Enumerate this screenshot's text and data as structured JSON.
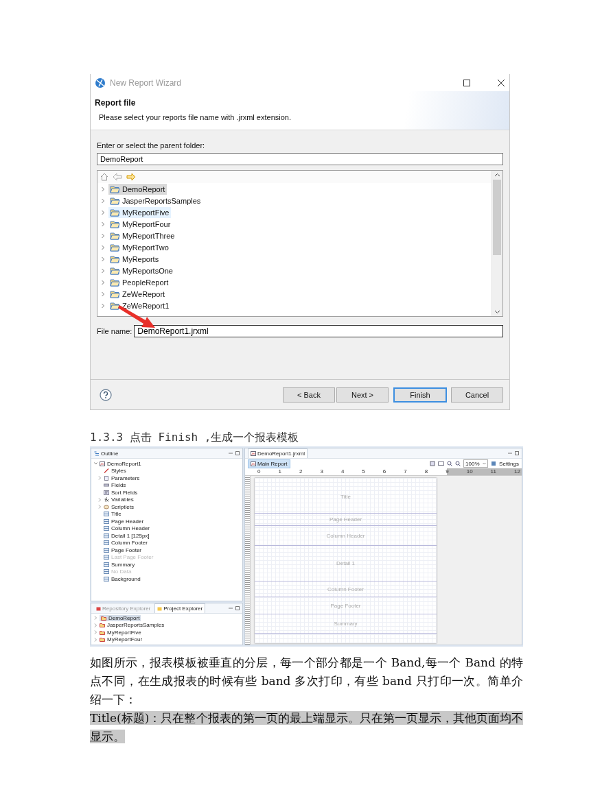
{
  "dialog": {
    "title": "New Report Wizard",
    "heading": "Report file",
    "description": "Please select your reports file name with .jrxml extension.",
    "folder_label": "Enter or select the parent folder:",
    "folder_value": "DemoReport",
    "folders": [
      {
        "name": "DemoReport",
        "selected": true,
        "hovered": false
      },
      {
        "name": "JasperReportsSamples",
        "selected": false,
        "hovered": false
      },
      {
        "name": "MyReportFive",
        "selected": false,
        "hovered": true
      },
      {
        "name": "MyReportFour",
        "selected": false,
        "hovered": false
      },
      {
        "name": "MyReportThree",
        "selected": false,
        "hovered": false
      },
      {
        "name": "MyReportTwo",
        "selected": false,
        "hovered": false
      },
      {
        "name": "MyReports",
        "selected": false,
        "hovered": false
      },
      {
        "name": "MyReportsOne",
        "selected": false,
        "hovered": false
      },
      {
        "name": "PeopleReport",
        "selected": false,
        "hovered": false
      },
      {
        "name": "ZeWeReport",
        "selected": false,
        "hovered": false
      },
      {
        "name": "ZeWeReport1",
        "selected": false,
        "hovered": false
      }
    ],
    "file_label": "File name:",
    "file_value": "DemoReport1.jrxml",
    "buttons": [
      {
        "label": "< Back",
        "default": false
      },
      {
        "label": "Next >",
        "default": false
      },
      {
        "label": "Finish",
        "default": true
      },
      {
        "label": "Cancel",
        "default": false
      }
    ]
  },
  "heading": "1.3.3 点击 Finish ,生成一个报表模板",
  "ide": {
    "outline": {
      "title": "Outline",
      "root": "DemoReport1",
      "items": [
        {
          "label": "Styles",
          "kind": "styles",
          "expandable": false,
          "disabled": false
        },
        {
          "label": "Parameters",
          "kind": "parameters",
          "expandable": true,
          "disabled": false
        },
        {
          "label": "Fields",
          "kind": "fields",
          "expandable": false,
          "disabled": false
        },
        {
          "label": "Sort Fields",
          "kind": "sort",
          "expandable": false,
          "disabled": false
        },
        {
          "label": "Variables",
          "kind": "variables",
          "expandable": true,
          "disabled": false
        },
        {
          "label": "Scriptlets",
          "kind": "scriptlets",
          "expandable": true,
          "disabled": false
        },
        {
          "label": "Title",
          "kind": "band",
          "expandable": false,
          "disabled": false
        },
        {
          "label": "Page Header",
          "kind": "band",
          "expandable": false,
          "disabled": false
        },
        {
          "label": "Column Header",
          "kind": "band",
          "expandable": false,
          "disabled": false
        },
        {
          "label": "Detail 1 [125px]",
          "kind": "band",
          "expandable": false,
          "disabled": false
        },
        {
          "label": "Column Footer",
          "kind": "band",
          "expandable": false,
          "disabled": false
        },
        {
          "label": "Page Footer",
          "kind": "band",
          "expandable": false,
          "disabled": false
        },
        {
          "label": "Last Page Footer",
          "kind": "band",
          "expandable": false,
          "disabled": true
        },
        {
          "label": "Summary",
          "kind": "band",
          "expandable": false,
          "disabled": false
        },
        {
          "label": "No Data",
          "kind": "band",
          "expandable": false,
          "disabled": true
        },
        {
          "label": "Background",
          "kind": "band",
          "expandable": false,
          "disabled": false
        }
      ]
    },
    "explorer": {
      "tabs": [
        {
          "label": "Repository Explorer",
          "selected": false
        },
        {
          "label": "Project Explorer",
          "selected": true
        }
      ],
      "projects": [
        {
          "name": "DemoReport",
          "selected": true
        },
        {
          "name": "JasperReportsSamples",
          "selected": false
        },
        {
          "name": "MyReportFive",
          "selected": false
        },
        {
          "name": "MyReportFour",
          "selected": false
        }
      ]
    },
    "editor": {
      "tab": "DemoReport1.jrxml",
      "main_report": "Main Report",
      "zoom": "100%",
      "settings": "Settings",
      "ruler": [
        "0",
        "1",
        "2",
        "3",
        "4",
        "5",
        "6",
        "7",
        "8",
        "9",
        "10",
        "11",
        "12"
      ],
      "bands": [
        "Title",
        "Page Header",
        "Column Header",
        "Detail 1",
        "Column Footer",
        "Page Footer",
        "Summary"
      ]
    }
  },
  "paragraphs": [
    {
      "text": "如图所示，报表模板被垂直的分层，每一个部分都是一个 Band,每一个 Band 的特点不同，在生成报表的时候有些 band 多次打印，有些 band 只打印一次。简单介绍一下：",
      "highlighted": false
    },
    {
      "text": "Title(标题)：只在整个报表的第一页的最上端显示。只在第一页显示，其他页面均不显示。",
      "highlighted": true
    }
  ]
}
